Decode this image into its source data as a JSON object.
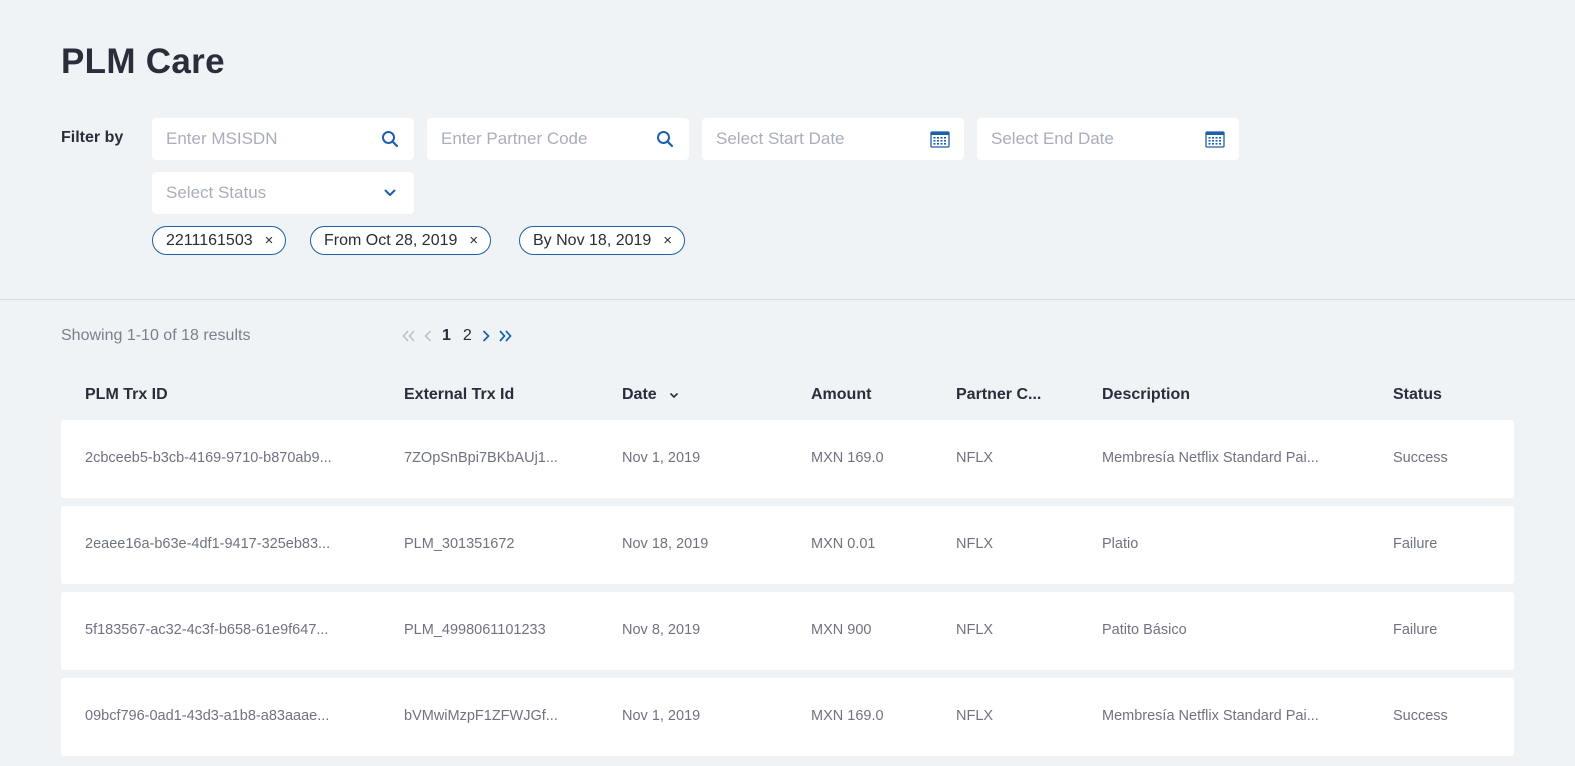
{
  "page": {
    "title": "PLM Care"
  },
  "filters": {
    "label": "Filter by",
    "msisdn_placeholder": "Enter MSISDN",
    "partner_code_placeholder": "Enter Partner Code",
    "start_date_placeholder": "Select Start Date",
    "end_date_placeholder": "Select End Date",
    "status_placeholder": "Select Status",
    "chips": [
      {
        "label": "2211161503"
      },
      {
        "label": "From Oct 28, 2019"
      },
      {
        "label": "By Nov 18, 2019"
      }
    ],
    "chip_close_glyph": "×"
  },
  "results": {
    "summary": "Showing 1-10 of 18 results",
    "pages": [
      "1",
      "2"
    ],
    "current_page": "1"
  },
  "table": {
    "columns": [
      "PLM Trx ID",
      "External Trx Id",
      "Date",
      "Amount",
      "Partner C...",
      "Description",
      "Status"
    ],
    "rows": [
      [
        "2cbceeb5-b3cb-4169-9710-b870ab9...",
        "7ZOpSnBpi7BKbAUj1...",
        "Nov 1, 2019",
        "MXN 169.0",
        "NFLX",
        "Membresía Netflix Standard Pai...",
        "Success"
      ],
      [
        "2eaee16a-b63e-4df1-9417-325eb83...",
        "PLM_301351672",
        "Nov 18, 2019",
        "MXN 0.01",
        "NFLX",
        "Platio",
        "Failure"
      ],
      [
        "5f183567-ac32-4c3f-b658-61e9f647...",
        "PLM_4998061101233",
        "Nov 8, 2019",
        "MXN 900",
        "NFLX",
        "Patito Básico",
        "Failure"
      ],
      [
        "09bcf796-0ad1-43d3-a1b8-a83aaae...",
        "bVMwiMzpF1ZFWJGf...",
        "Nov 1, 2019",
        "MXN 169.0",
        "NFLX",
        "Membresía Netflix Standard Pai...",
        "Success"
      ]
    ]
  },
  "colors": {
    "accent": "#1d5fa8",
    "background": "#eff3f6",
    "card": "#ffffff"
  },
  "icons": [
    "search-icon",
    "calendar-icon",
    "chevron-down-icon",
    "close-icon",
    "first-page-icon",
    "prev-page-icon",
    "next-page-icon",
    "last-page-icon",
    "sort-desc-icon"
  ]
}
